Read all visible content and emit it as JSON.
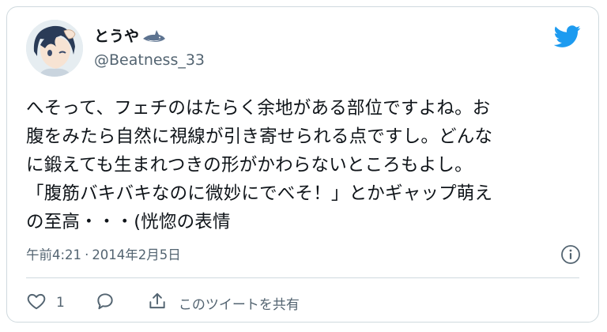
{
  "user": {
    "display_name": "とうや",
    "handle": "@Beatness_33",
    "name_emoji": "shark-emoji"
  },
  "tweet": {
    "text": "へそって、フェチのはたらく余地がある部位ですよね。お\n腹をみたら自然に視線が引き寄せられる点ですし。どんな\nに鍛えても生まれつきの形がかわらないところもよし。\n「腹筋バキバキなのに微妙にでべそ！」とかギャップ萌え\nの至高・・・(恍惚の表情",
    "time": "午前4:21",
    "separator": "·",
    "date": "2014年2月5日"
  },
  "actions": {
    "like_count": "1",
    "share_label": "このツイートを共有"
  },
  "icons": {
    "brand": "twitter-bird-icon",
    "info": "info-icon",
    "like": "heart-icon",
    "reply": "reply-icon",
    "share": "share-icon"
  },
  "colors": {
    "twitter_blue": "#1d9bf0",
    "secondary_text": "#536471",
    "border": "#cfd9de"
  }
}
